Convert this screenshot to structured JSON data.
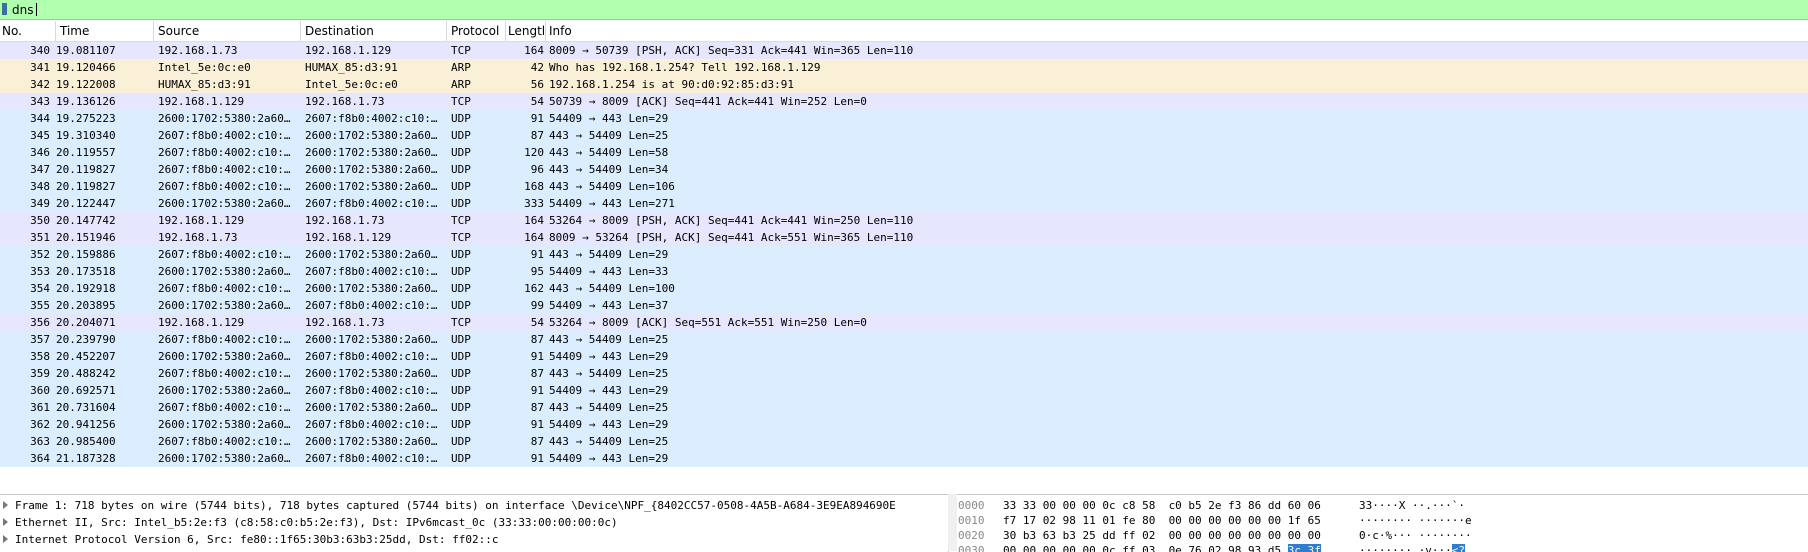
{
  "filter": {
    "value": "dns"
  },
  "columns": {
    "no": "No.",
    "time": "Time",
    "source": "Source",
    "destination": "Destination",
    "protocol": "Protocol",
    "length": "Lengtl",
    "info": "Info"
  },
  "colors": {
    "tcp_row": "#e7e6ff",
    "arp_row": "#faf0d7",
    "udp_row": "#daeeff",
    "filter_bg": "#afffaf",
    "hex_highlight": "#2f7cd1"
  },
  "packets": [
    {
      "no": "340",
      "time": "19.081107",
      "source": "192.168.1.73",
      "destination": "192.168.1.129",
      "protocol": "TCP",
      "length": "164",
      "info": "8009 → 50739 [PSH, ACK] Seq=331 Ack=441 Win=365 Len=110",
      "color": "tcp"
    },
    {
      "no": "341",
      "time": "19.120466",
      "source": "Intel_5e:0c:e0",
      "destination": "HUMAX_85:d3:91",
      "protocol": "ARP",
      "length": "42",
      "info": "Who has 192.168.1.254? Tell 192.168.1.129",
      "color": "arp"
    },
    {
      "no": "342",
      "time": "19.122008",
      "source": "HUMAX_85:d3:91",
      "destination": "Intel_5e:0c:e0",
      "protocol": "ARP",
      "length": "56",
      "info": "192.168.1.254 is at 90:d0:92:85:d3:91",
      "color": "arp"
    },
    {
      "no": "343",
      "time": "19.136126",
      "source": "192.168.1.129",
      "destination": "192.168.1.73",
      "protocol": "TCP",
      "length": "54",
      "info": "50739 → 8009 [ACK] Seq=441 Ack=441 Win=252 Len=0",
      "color": "tcp"
    },
    {
      "no": "344",
      "time": "19.275223",
      "source": "2600:1702:5380:2a60…",
      "destination": "2607:f8b0:4002:c10:…",
      "protocol": "UDP",
      "length": "91",
      "info": "54409 → 443 Len=29",
      "color": "udp"
    },
    {
      "no": "345",
      "time": "19.310340",
      "source": "2607:f8b0:4002:c10:…",
      "destination": "2600:1702:5380:2a60…",
      "protocol": "UDP",
      "length": "87",
      "info": "443 → 54409 Len=25",
      "color": "udp"
    },
    {
      "no": "346",
      "time": "20.119557",
      "source": "2607:f8b0:4002:c10:…",
      "destination": "2600:1702:5380:2a60…",
      "protocol": "UDP",
      "length": "120",
      "info": "443 → 54409 Len=58",
      "color": "udp"
    },
    {
      "no": "347",
      "time": "20.119827",
      "source": "2607:f8b0:4002:c10:…",
      "destination": "2600:1702:5380:2a60…",
      "protocol": "UDP",
      "length": "96",
      "info": "443 → 54409 Len=34",
      "color": "udp"
    },
    {
      "no": "348",
      "time": "20.119827",
      "source": "2607:f8b0:4002:c10:…",
      "destination": "2600:1702:5380:2a60…",
      "protocol": "UDP",
      "length": "168",
      "info": "443 → 54409 Len=106",
      "color": "udp"
    },
    {
      "no": "349",
      "time": "20.122447",
      "source": "2600:1702:5380:2a60…",
      "destination": "2607:f8b0:4002:c10:…",
      "protocol": "UDP",
      "length": "333",
      "info": "54409 → 443 Len=271",
      "color": "udp"
    },
    {
      "no": "350",
      "time": "20.147742",
      "source": "192.168.1.129",
      "destination": "192.168.1.73",
      "protocol": "TCP",
      "length": "164",
      "info": "53264 → 8009 [PSH, ACK] Seq=441 Ack=441 Win=250 Len=110",
      "color": "tcp"
    },
    {
      "no": "351",
      "time": "20.151946",
      "source": "192.168.1.73",
      "destination": "192.168.1.129",
      "protocol": "TCP",
      "length": "164",
      "info": "8009 → 53264 [PSH, ACK] Seq=441 Ack=551 Win=365 Len=110",
      "color": "tcp"
    },
    {
      "no": "352",
      "time": "20.159886",
      "source": "2607:f8b0:4002:c10:…",
      "destination": "2600:1702:5380:2a60…",
      "protocol": "UDP",
      "length": "91",
      "info": "443 → 54409 Len=29",
      "color": "udp"
    },
    {
      "no": "353",
      "time": "20.173518",
      "source": "2600:1702:5380:2a60…",
      "destination": "2607:f8b0:4002:c10:…",
      "protocol": "UDP",
      "length": "95",
      "info": "54409 → 443 Len=33",
      "color": "udp"
    },
    {
      "no": "354",
      "time": "20.192918",
      "source": "2607:f8b0:4002:c10:…",
      "destination": "2600:1702:5380:2a60…",
      "protocol": "UDP",
      "length": "162",
      "info": "443 → 54409 Len=100",
      "color": "udp"
    },
    {
      "no": "355",
      "time": "20.203895",
      "source": "2600:1702:5380:2a60…",
      "destination": "2607:f8b0:4002:c10:…",
      "protocol": "UDP",
      "length": "99",
      "info": "54409 → 443 Len=37",
      "color": "udp"
    },
    {
      "no": "356",
      "time": "20.204071",
      "source": "192.168.1.129",
      "destination": "192.168.1.73",
      "protocol": "TCP",
      "length": "54",
      "info": "53264 → 8009 [ACK] Seq=551 Ack=551 Win=250 Len=0",
      "color": "tcp"
    },
    {
      "no": "357",
      "time": "20.239790",
      "source": "2607:f8b0:4002:c10:…",
      "destination": "2600:1702:5380:2a60…",
      "protocol": "UDP",
      "length": "87",
      "info": "443 → 54409 Len=25",
      "color": "udp"
    },
    {
      "no": "358",
      "time": "20.452207",
      "source": "2600:1702:5380:2a60…",
      "destination": "2607:f8b0:4002:c10:…",
      "protocol": "UDP",
      "length": "91",
      "info": "54409 → 443 Len=29",
      "color": "udp"
    },
    {
      "no": "359",
      "time": "20.488242",
      "source": "2607:f8b0:4002:c10:…",
      "destination": "2600:1702:5380:2a60…",
      "protocol": "UDP",
      "length": "87",
      "info": "443 → 54409 Len=25",
      "color": "udp"
    },
    {
      "no": "360",
      "time": "20.692571",
      "source": "2600:1702:5380:2a60…",
      "destination": "2607:f8b0:4002:c10:…",
      "protocol": "UDP",
      "length": "91",
      "info": "54409 → 443 Len=29",
      "color": "udp"
    },
    {
      "no": "361",
      "time": "20.731604",
      "source": "2607:f8b0:4002:c10:…",
      "destination": "2600:1702:5380:2a60…",
      "protocol": "UDP",
      "length": "87",
      "info": "443 → 54409 Len=25",
      "color": "udp"
    },
    {
      "no": "362",
      "time": "20.941256",
      "source": "2600:1702:5380:2a60…",
      "destination": "2607:f8b0:4002:c10:…",
      "protocol": "UDP",
      "length": "91",
      "info": "54409 → 443 Len=29",
      "color": "udp"
    },
    {
      "no": "363",
      "time": "20.985400",
      "source": "2607:f8b0:4002:c10:…",
      "destination": "2600:1702:5380:2a60…",
      "protocol": "UDP",
      "length": "87",
      "info": "443 → 54409 Len=25",
      "color": "udp"
    },
    {
      "no": "364",
      "time": "21.187328",
      "source": "2600:1702:5380:2a60…",
      "destination": "2607:f8b0:4002:c10:…",
      "protocol": "UDP",
      "length": "91",
      "info": "54409 → 443 Len=29",
      "color": "udp"
    }
  ],
  "details": [
    {
      "text": "Frame 1: 718 bytes on wire (5744 bits), 718 bytes captured (5744 bits) on interface \\Device\\NPF_{8402CC57-0508-4A5B-A684-3E9EA894690E"
    },
    {
      "text": "Ethernet II, Src: Intel_b5:2e:f3 (c8:58:c0:b5:2e:f3), Dst: IPv6mcast_0c (33:33:00:00:00:0c)"
    },
    {
      "text": "Internet Protocol Version 6, Src: fe80::1f65:30b3:63b3:25dd, Dst: ff02::c"
    }
  ],
  "hex": [
    {
      "offset": "0000",
      "bytes": "33 33 00 00 00 0c c8 58  c0 b5 2e f3 86 dd 60 06",
      "ascii": "33····X ··.···`·",
      "hl_bytes": "",
      "hl_ascii": ""
    },
    {
      "offset": "0010",
      "bytes": "f7 17 02 98 11 01 fe 80  00 00 00 00 00 00 1f 65",
      "ascii": "········ ·······e",
      "hl_bytes": "",
      "hl_ascii": ""
    },
    {
      "offset": "0020",
      "bytes": "30 b3 63 b3 25 dd ff 02  00 00 00 00 00 00 00 00",
      "ascii": "0·c·%··· ········",
      "hl_bytes": "",
      "hl_ascii": ""
    },
    {
      "offset": "0030",
      "bytes": "00 00 00 00 00 0c ff 03  0e 76 02 98 93 d5 ",
      "ascii": "········ ·v···",
      "hl_bytes": "3c 3f",
      "hl_ascii": "<?"
    }
  ]
}
